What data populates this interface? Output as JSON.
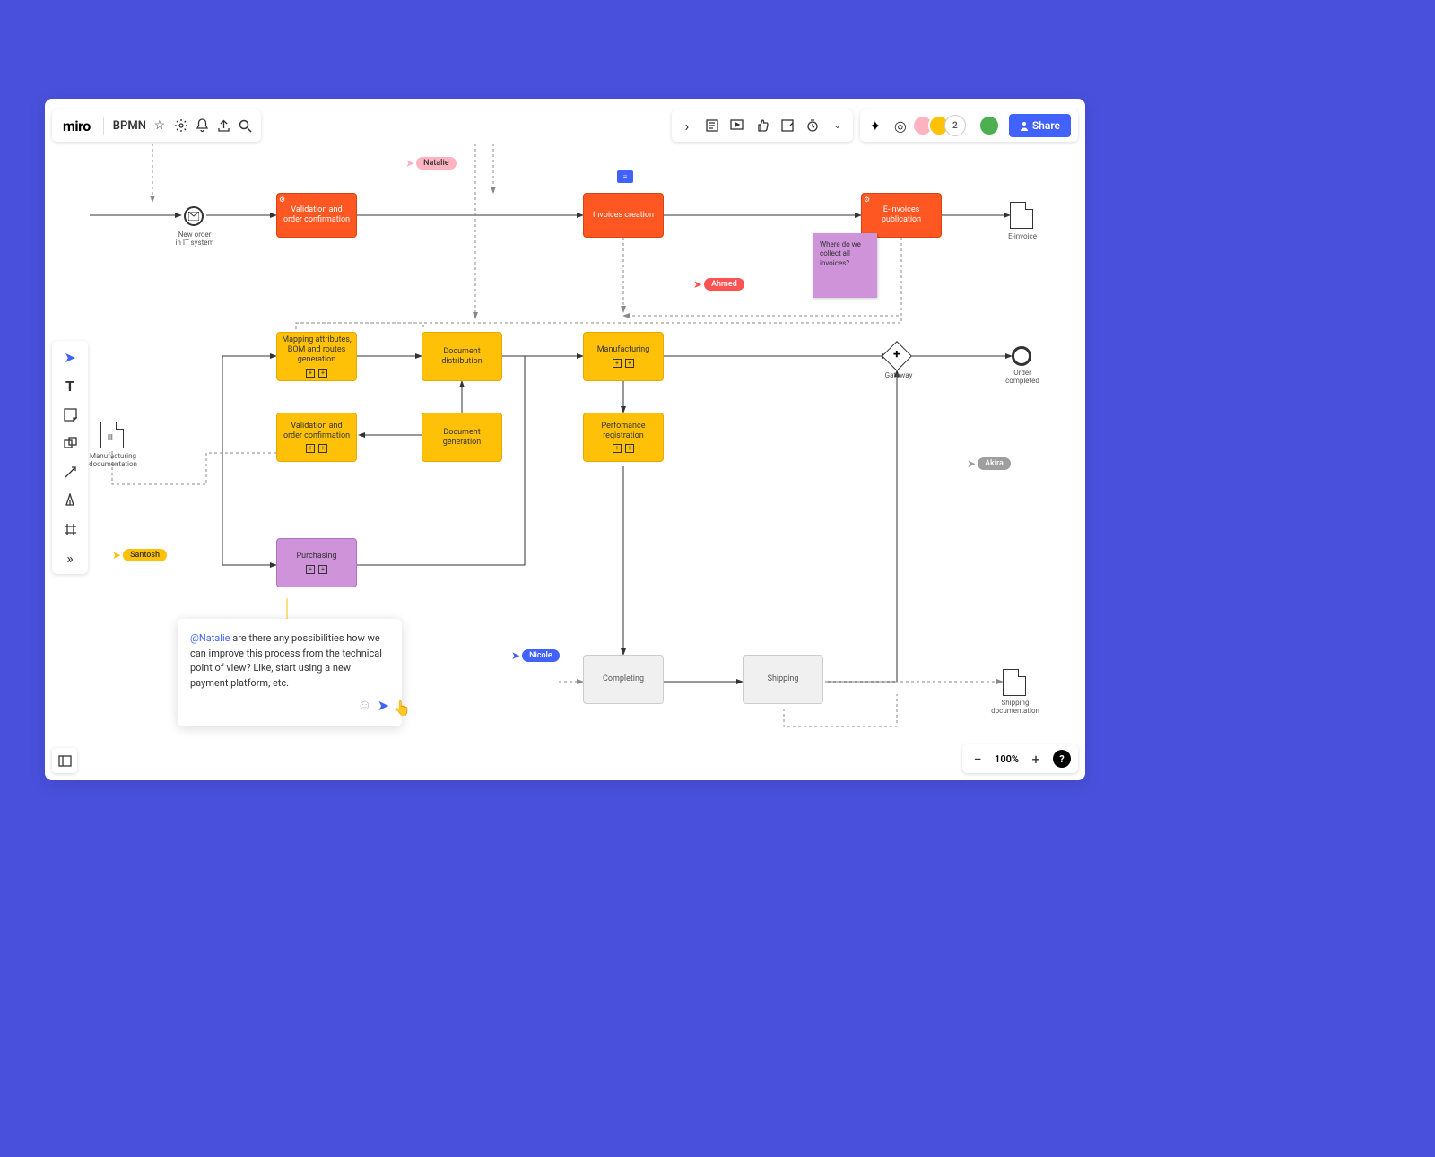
{
  "app": {
    "logo": "miro",
    "board": "BPMN"
  },
  "share": "Share",
  "avatar_count": "2",
  "nodes": {
    "validation1": "Validation and order confirmation",
    "invoices_creation": "Invoices creation",
    "einvoices": "E-invoices publication",
    "mapping": "Mapping attributes, BOM and routes generation",
    "docdist": "Document distribution",
    "manufacturing": "Manufacturing",
    "validation2": "Validation and order confirmation",
    "docgen": "Document generation",
    "performance": "Perfomance registration",
    "purchasing": "Purchasing",
    "completing": "Completing",
    "shipping": "Shipping"
  },
  "labels": {
    "new_order": "New order\nin IT system",
    "einvoice": "E-invoice",
    "gateway": "Gateway",
    "order_completed": "Order\ncompleted",
    "mfg_doc": "Manufacturing\ndocumentation",
    "ship_doc": "Shipping\ndocumentation"
  },
  "cursors": {
    "natalie": "Natalie",
    "ahmed": "Ahmed",
    "santosh": "Santosh",
    "nicole": "Nicole",
    "akira": "Akira"
  },
  "sticky": "Where do we collect all invoices?",
  "comment": {
    "mention": "@Natalie",
    "text": " are there any possibilities how we can improve this process from the technical point of view? Like, start using a new payment platform, etc."
  },
  "zoom": "100%"
}
